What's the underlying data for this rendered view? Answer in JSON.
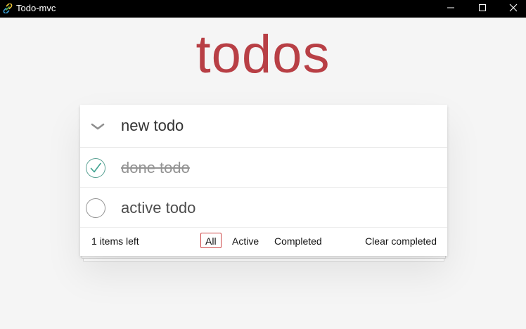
{
  "window": {
    "title": "Todo-mvc",
    "app_icon": "link-icon",
    "controls": {
      "minimize_icon": "minimize-icon",
      "maximize_icon": "maximize-icon",
      "close_icon": "close-icon"
    }
  },
  "app": {
    "title": "todos",
    "title_color": "#b83f45"
  },
  "new_todo": {
    "value": "new todo",
    "toggle_icon": "chevron-down-icon"
  },
  "todos": [
    {
      "label": "done todo",
      "completed": true,
      "check_icon": "checkmark-circle-icon"
    },
    {
      "label": "active todo",
      "completed": false,
      "check_icon": "empty-circle-icon"
    }
  ],
  "footer": {
    "count_text": "1 items left",
    "filters": [
      {
        "label": "All",
        "selected": true
      },
      {
        "label": "Active",
        "selected": false
      },
      {
        "label": "Completed",
        "selected": false
      }
    ],
    "clear_label": "Clear completed",
    "selected_border_color": "#ce4646"
  }
}
